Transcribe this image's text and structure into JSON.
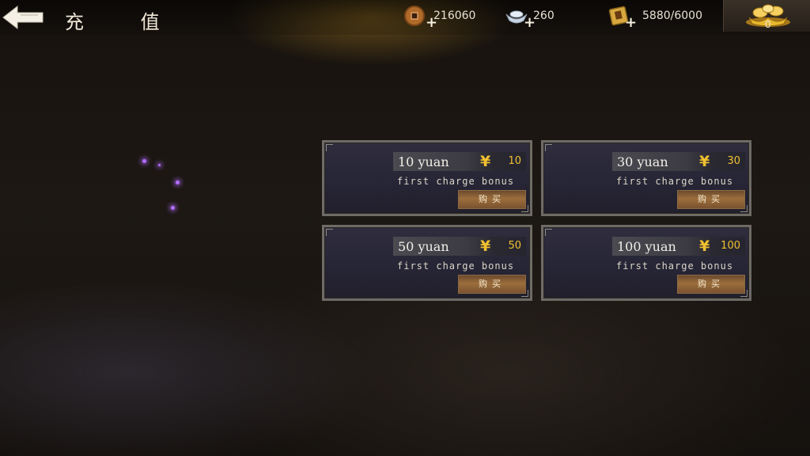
{
  "header": {
    "title": "充 值",
    "resources": {
      "copper": "216060",
      "silver": "260",
      "stamina": "5880/6000",
      "ingot": "0"
    }
  },
  "products": [
    {
      "price_label": "10 yuan",
      "price_value": "10",
      "bonus": "first charge bonus",
      "buy": "购买"
    },
    {
      "price_label": "30 yuan",
      "price_value": "30",
      "bonus": "first charge bonus",
      "buy": "购买"
    },
    {
      "price_label": "50 yuan",
      "price_value": "50",
      "bonus": "first charge bonus",
      "buy": "购买"
    },
    {
      "price_label": "100 yuan",
      "price_value": "100",
      "bonus": "first charge bonus",
      "buy": "购买"
    }
  ],
  "colors": {
    "gold": "#f0c030",
    "card_border": "#6e6a66",
    "card_bg": "#2f2d3e"
  },
  "icons": {
    "back": "back-arrow-icon",
    "copper": "copper-coin-icon",
    "silver": "silver-ingot-icon",
    "stamina": "scroll-book-icon",
    "ingot": "gold-ingot-icon",
    "yen": "yen-icon"
  }
}
